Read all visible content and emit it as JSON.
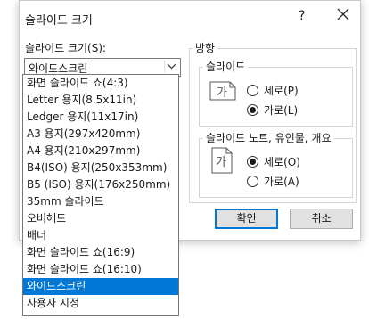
{
  "dialog": {
    "title": "슬라이드 크기",
    "help_label": "?",
    "size_label": "슬라이드 크기(S):",
    "selected_size": "와이드스크린",
    "size_options": [
      "화면 슬라이드 쇼(4:3)",
      "Letter 용지(8.5x11in)",
      "Ledger 용지(11x17in)",
      "A3 용지(297x420mm)",
      "A4 용지(210x297mm)",
      "B4(ISO) 용지(250x353mm)",
      "B5 (ISO) 용지(176x250mm)",
      "35mm 슬라이드",
      "오버헤드",
      "배너",
      "화면 슬라이드 쇼(16:9)",
      "화면 슬라이드 쇼(16:10)",
      "와이드스크린",
      "사용자 지정"
    ],
    "orientation_label": "방향",
    "slides_group": {
      "label": "슬라이드",
      "icon_char": "가",
      "portrait_label": "세로(P)",
      "landscape_label": "가로(L)",
      "selected": "landscape"
    },
    "notes_group": {
      "label": "슬라이드 노트, 유인물, 개요",
      "icon_char": "가",
      "portrait_label": "세로(O)",
      "landscape_label": "가로(A)",
      "selected": "portrait"
    },
    "ok_label": "확인",
    "cancel_label": "취소"
  }
}
